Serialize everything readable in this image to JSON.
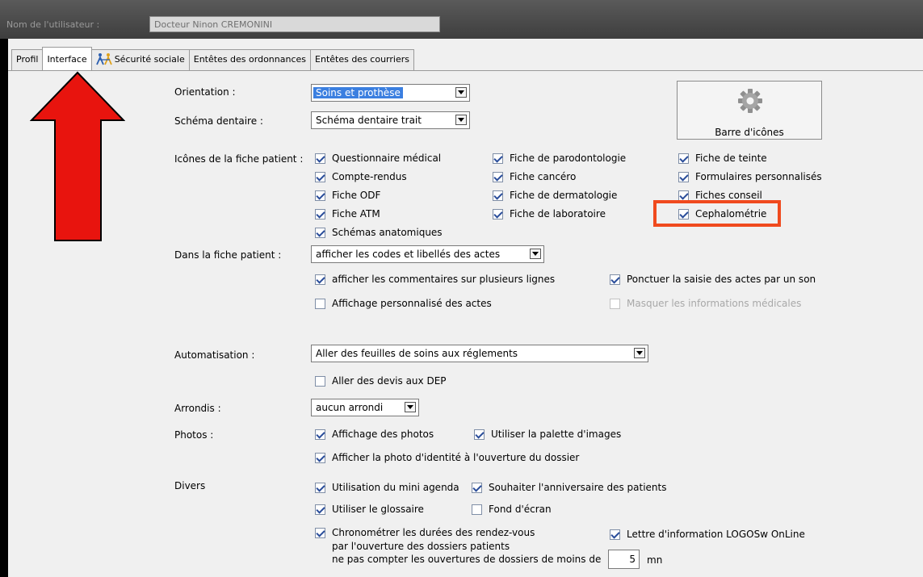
{
  "user": {
    "label": "Nom de l'utilisateur :",
    "value": "Docteur Ninon CREMONINI"
  },
  "tabs": [
    {
      "label": "Profil"
    },
    {
      "label": "Interface"
    },
    {
      "label": "Sécurité sociale",
      "icon": "social-security-icon"
    },
    {
      "label": "Entêtes des ordonnances"
    },
    {
      "label": "Entêtes des courriers"
    }
  ],
  "orientation": {
    "label": "Orientation :",
    "value": "Soins et prothèse"
  },
  "schema": {
    "label": "Schéma dentaire :",
    "value": "Schéma dentaire trait"
  },
  "icon_button": {
    "label": "Barre d'icônes",
    "icon": "gear-icon"
  },
  "icones": {
    "label": "Icônes de la fiche patient :",
    "items": [
      {
        "label": "Questionnaire médical",
        "checked": true
      },
      {
        "label": "Compte-rendus",
        "checked": true
      },
      {
        "label": "Fiche ODF",
        "checked": true
      },
      {
        "label": "Fiche ATM",
        "checked": true
      },
      {
        "label": "Schémas anatomiques",
        "checked": true
      },
      {
        "label": "Fiche de parodontologie",
        "checked": true
      },
      {
        "label": "Fiche cancéro",
        "checked": true
      },
      {
        "label": "Fiche de dermatologie",
        "checked": true
      },
      {
        "label": "Fiche de laboratoire",
        "checked": true
      },
      {
        "label": "Fiche de teinte",
        "checked": true
      },
      {
        "label": "Formulaires personnalisés",
        "checked": true
      },
      {
        "label": "Fiches conseil",
        "checked": true
      },
      {
        "label": "Cephalométrie",
        "checked": true
      }
    ]
  },
  "fiche": {
    "label": "Dans la fiche patient :",
    "value": "afficher les codes et libellés des actes",
    "commentaires": "afficher les commentaires sur plusieurs lignes",
    "ponctuer": "Ponctuer la saisie des actes par un son",
    "affichage_perso": "Affichage personnalisé des actes",
    "masquer": "Masquer les informations médicales"
  },
  "automatisation": {
    "label": "Automatisation :",
    "value": "Aller des feuilles de soins aux réglements",
    "devis": "Aller des devis aux DEP"
  },
  "arrondis": {
    "label": "Arrondis :",
    "value": "aucun arrondi"
  },
  "photos": {
    "label": "Photos :",
    "affichage": "Affichage des photos",
    "palette": "Utiliser la palette d'images",
    "identite": "Afficher la photo d'identité à l'ouverture du dossier"
  },
  "divers": {
    "label": "Divers",
    "mini_agenda": "Utilisation du mini agenda",
    "anniversaire": "Souhaiter l'anniversaire des patients",
    "glossaire": "Utiliser le glossaire",
    "fond": "Fond d'écran",
    "chrono_line1": "Chronométrer les durées des rendez-vous",
    "chrono_line2": "par l'ouverture des dossiers patients",
    "chrono_line3": "ne pas compter les ouvertures de dossiers de moins de",
    "minutes_value": "5",
    "minutes_unit": "mn",
    "lettre": "Lettre d'information LOGOSw OnLine"
  },
  "colors": {
    "accent_highlight": "#f04a1e",
    "arrow": "#e8140e",
    "selection": "#3b7fe0"
  }
}
